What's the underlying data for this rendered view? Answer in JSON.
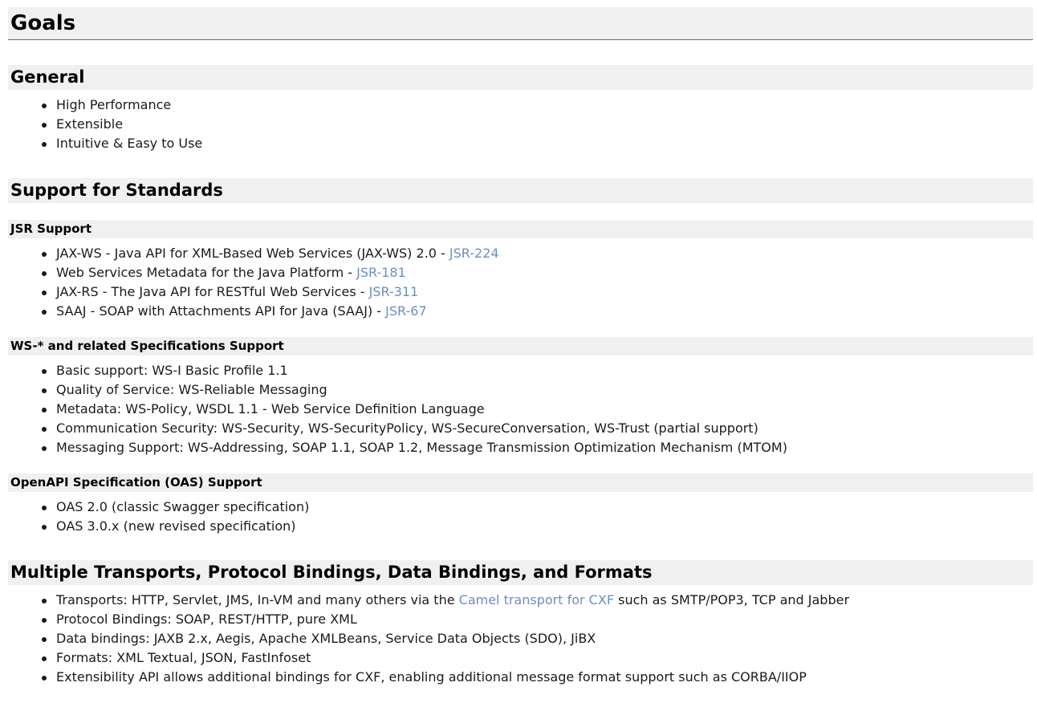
{
  "page_title": "Goals",
  "general": {
    "heading": "General",
    "items": [
      "High Performance",
      "Extensible",
      "Intuitive & Easy to Use"
    ]
  },
  "standards": {
    "heading": "Support for Standards",
    "jsr": {
      "heading": "JSR Support",
      "items": [
        {
          "text": "JAX-WS - Java API for XML-Based Web Services (JAX-WS) 2.0 - ",
          "link": "JSR-224"
        },
        {
          "text": "Web Services Metadata for the Java Platform - ",
          "link": "JSR-181"
        },
        {
          "text": "JAX-RS - The Java API for RESTful Web Services - ",
          "link": "JSR-311"
        },
        {
          "text": "SAAJ - SOAP with Attachments API for Java (SAAJ) - ",
          "link": "JSR-67"
        }
      ]
    },
    "ws": {
      "heading": "WS-* and related Specifications Support",
      "items": [
        "Basic support: WS-I Basic Profile 1.1",
        "Quality of Service: WS-Reliable Messaging",
        "Metadata: WS-Policy, WSDL 1.1 - Web Service Definition Language",
        "Communication Security: WS-Security, WS-SecurityPolicy, WS-SecureConversation, WS-Trust (partial support)",
        "Messaging Support: WS-Addressing, SOAP 1.1, SOAP 1.2, Message Transmission Optimization Mechanism (MTOM)"
      ]
    },
    "oas": {
      "heading": "OpenAPI Specification (OAS) Support",
      "items": [
        "OAS 2.0 (classic Swagger specification)",
        "OAS 3.0.x (new revised specification)"
      ]
    }
  },
  "transports": {
    "heading": "Multiple Transports, Protocol Bindings, Data Bindings, and Formats",
    "item0_before": "Transports: HTTP, Servlet, JMS, In-VM and many others via the ",
    "item0_link": "Camel transport for CXF",
    "item0_after": " such as SMTP/POP3, TCP and Jabber",
    "items": [
      "Protocol Bindings: SOAP, REST/HTTP, pure XML",
      "Data bindings: JAXB 2.x, Aegis, Apache XMLBeans, Service Data Objects (SDO), JiBX",
      "Formats: XML Textual, JSON, FastInfoset",
      "Extensibility API allows additional bindings for CXF, enabling additional message format support such as CORBA/IIOP"
    ]
  },
  "colors": {
    "heading_bg": "#f0f0f0",
    "title_rule": "#3572b0",
    "link": "#6a8fc0"
  }
}
